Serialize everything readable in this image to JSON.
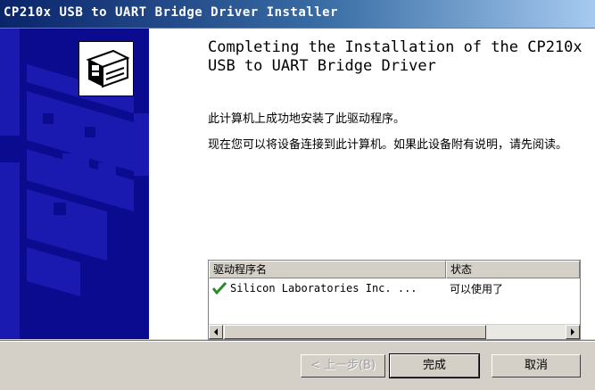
{
  "window": {
    "title": "CP210x USB to UART Bridge Driver Installer"
  },
  "content": {
    "heading": "Completing the Installation of the CP210x USB to UART Bridge Driver",
    "paragraph1": "此计算机上成功地安装了此驱动程序。",
    "paragraph2": "现在您可以将设备连接到此计算机。如果此设备附有说明，请先阅读。"
  },
  "driver_table": {
    "columns": [
      "驱动程序名",
      "状态"
    ],
    "rows": [
      {
        "icon": "check-icon",
        "name": "Silicon Laboratories Inc. ...",
        "status": "可以使用了"
      }
    ]
  },
  "buttons": {
    "back": "< 上一步(B)",
    "finish": "完成",
    "cancel": "取消"
  },
  "colors": {
    "sidebar": "#0b0b8f",
    "title_gradient_start": "#0a246a",
    "check": "#2a8a2a"
  }
}
